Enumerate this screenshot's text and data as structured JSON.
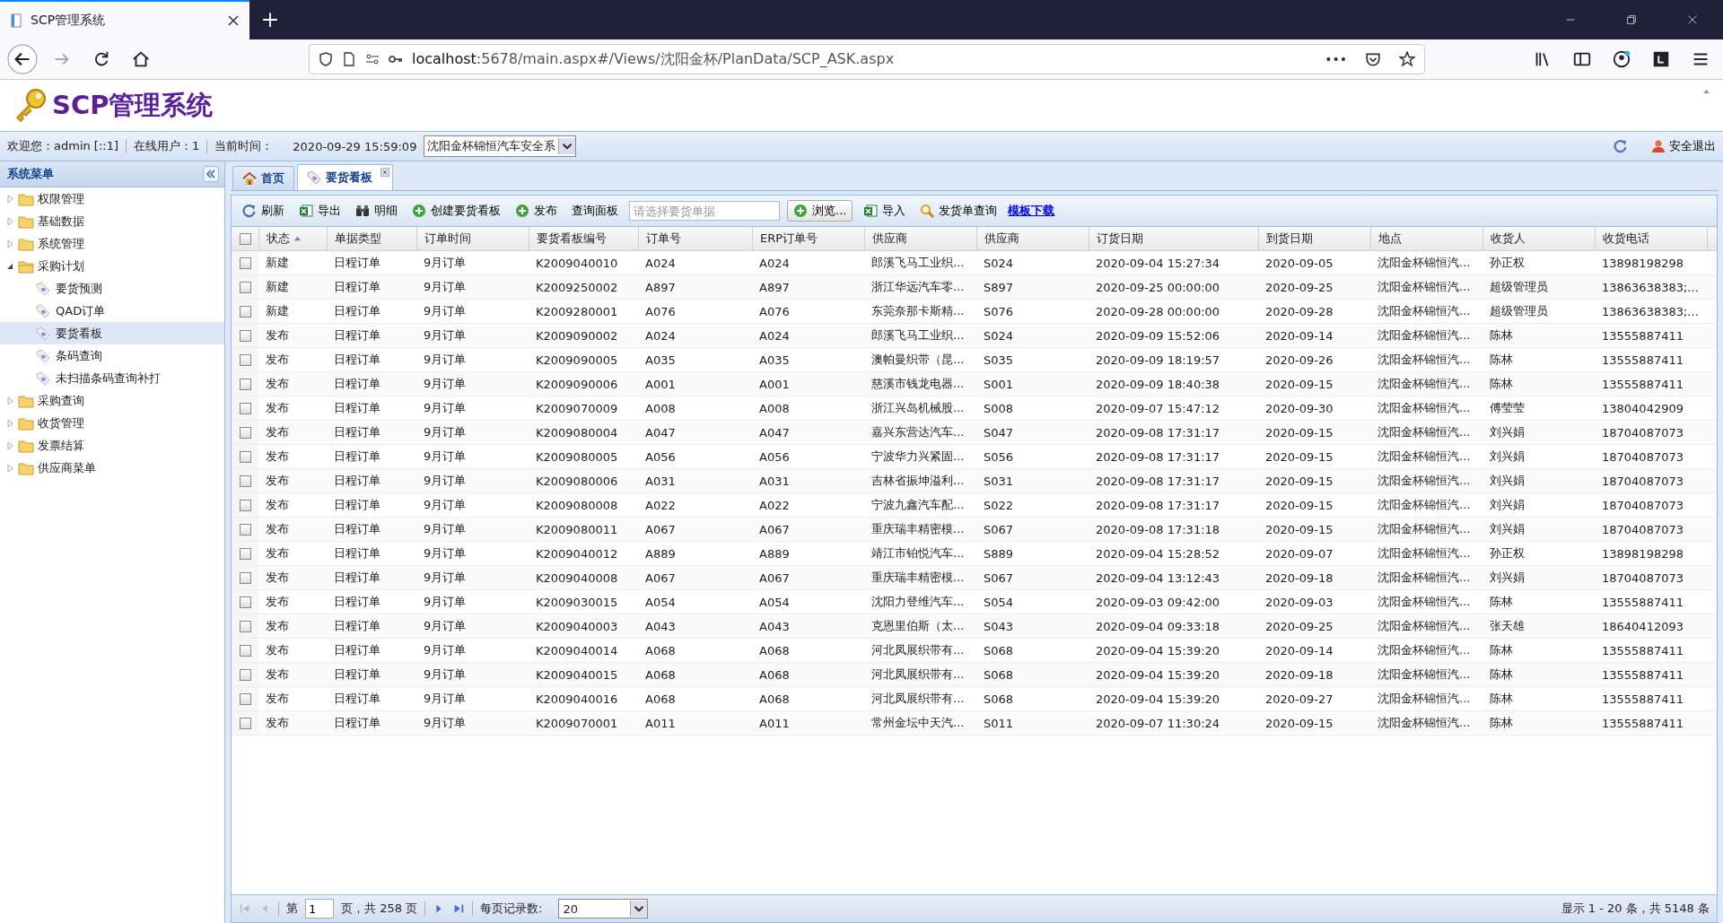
{
  "browser": {
    "tab_title": "SCP管理系统",
    "url_host": "localhost",
    "url_rest": ":5678/main.aspx#/Views/沈阳金杯/PlanData/SCP_ASK.aspx",
    "menu_dots": "•••"
  },
  "app_title": "SCP管理系统",
  "info_bar": {
    "welcome": "欢迎您：admin [::1]",
    "online": "在线用户：1",
    "time_label": "当前时间：",
    "time": "2020-09-29 15:59:09",
    "company": "沈阳金杯锦恒汽车安全系",
    "logout": "安全退出"
  },
  "sidebar": {
    "title": "系统菜单",
    "items": [
      {
        "label": "权限管理",
        "expanded": false
      },
      {
        "label": "基础数据",
        "expanded": false
      },
      {
        "label": "系统管理",
        "expanded": false
      },
      {
        "label": "采购计划",
        "expanded": true,
        "children": [
          {
            "label": "要货预测",
            "selected": false
          },
          {
            "label": "QAD订单",
            "selected": false
          },
          {
            "label": "要货看板",
            "selected": true
          },
          {
            "label": "条码查询",
            "selected": false
          },
          {
            "label": "未扫描条码查询补打",
            "selected": false
          }
        ]
      },
      {
        "label": "采购查询",
        "expanded": false
      },
      {
        "label": "收货管理",
        "expanded": false
      },
      {
        "label": "发票结算",
        "expanded": false
      },
      {
        "label": "供应商菜单",
        "expanded": false
      }
    ]
  },
  "tabs": [
    {
      "label": "首页",
      "closable": false,
      "selected": false
    },
    {
      "label": "要货看板",
      "closable": true,
      "selected": true
    }
  ],
  "toolbar": [
    {
      "kind": "refresh",
      "label": "刷新"
    },
    {
      "kind": "export",
      "label": "导出"
    },
    {
      "kind": "detail",
      "label": "明细"
    },
    {
      "kind": "create",
      "label": "创建要货看板"
    },
    {
      "kind": "publish",
      "label": "发布"
    },
    {
      "kind": "panel",
      "label": "查询面板"
    },
    {
      "kind": "field",
      "placeholder": "请选择要货单据"
    },
    {
      "kind": "browse",
      "label": "浏览..."
    },
    {
      "kind": "import",
      "label": "导入"
    },
    {
      "kind": "search",
      "label": "发货单查询"
    },
    {
      "kind": "link",
      "label": "模板下载"
    }
  ],
  "table": {
    "header_checked": false,
    "columns": [
      {
        "label": "状态",
        "sorted": true
      },
      {
        "label": "单据类型",
        "sorted": false
      },
      {
        "label": "订单时间",
        "sorted": false
      },
      {
        "label": "要货看板编号",
        "sorted": false
      },
      {
        "label": "订单号",
        "sorted": false
      },
      {
        "label": "ERP订单号",
        "sorted": false
      },
      {
        "label": "供应商",
        "sorted": false
      },
      {
        "label": "供应商",
        "sorted": false
      },
      {
        "label": "订货日期",
        "sorted": false
      },
      {
        "label": "到货日期",
        "sorted": false
      },
      {
        "label": "地点",
        "sorted": false
      },
      {
        "label": "收货人",
        "sorted": false
      },
      {
        "label": "收货电话",
        "sorted": false
      }
    ],
    "rows": [
      {
        "checked": false,
        "cells": [
          "新建",
          "日程订单",
          "9月订单",
          "K2009040010",
          "A024",
          "A024",
          "郎溪飞马工业织...",
          "S024",
          "2020-09-04 15:27:34",
          "2020-09-05",
          "沈阳金杯锦恒汽...",
          "孙正权",
          "13898198298"
        ]
      },
      {
        "checked": false,
        "cells": [
          "新建",
          "日程订单",
          "9月订单",
          "K2009250002",
          "A897",
          "A897",
          "浙江华远汽车零...",
          "S897",
          "2020-09-25 00:00:00",
          "2020-09-25",
          "沈阳金杯锦恒汽...",
          "超级管理员",
          "13863638383;..."
        ]
      },
      {
        "checked": false,
        "cells": [
          "新建",
          "日程订单",
          "9月订单",
          "K2009280001",
          "A076",
          "A076",
          "东莞奈那卡斯精...",
          "S076",
          "2020-09-28 00:00:00",
          "2020-09-28",
          "沈阳金杯锦恒汽...",
          "超级管理员",
          "13863638383;..."
        ]
      },
      {
        "checked": false,
        "cells": [
          "发布",
          "日程订单",
          "9月订单",
          "K2009090002",
          "A024",
          "A024",
          "郎溪飞马工业织...",
          "S024",
          "2020-09-09 15:52:06",
          "2020-09-14",
          "沈阳金杯锦恒汽...",
          "陈林",
          "13555887411"
        ]
      },
      {
        "checked": false,
        "cells": [
          "发布",
          "日程订单",
          "9月订单",
          "K2009090005",
          "A035",
          "A035",
          "澳帕曼织带（昆...",
          "S035",
          "2020-09-09 18:19:57",
          "2020-09-26",
          "沈阳金杯锦恒汽...",
          "陈林",
          "13555887411"
        ]
      },
      {
        "checked": false,
        "cells": [
          "发布",
          "日程订单",
          "9月订单",
          "K2009090006",
          "A001",
          "A001",
          "慈溪市钱龙电器...",
          "S001",
          "2020-09-09 18:40:38",
          "2020-09-15",
          "沈阳金杯锦恒汽...",
          "陈林",
          "13555887411"
        ]
      },
      {
        "checked": false,
        "cells": [
          "发布",
          "日程订单",
          "9月订单",
          "K2009070009",
          "A008",
          "A008",
          "浙江兴岛机械股...",
          "S008",
          "2020-09-07 15:47:12",
          "2020-09-30",
          "沈阳金杯锦恒汽...",
          "傅莹莹",
          "13804042909"
        ]
      },
      {
        "checked": false,
        "cells": [
          "发布",
          "日程订单",
          "9月订单",
          "K2009080004",
          "A047",
          "A047",
          "嘉兴东营达汽车...",
          "S047",
          "2020-09-08 17:31:17",
          "2020-09-15",
          "沈阳金杯锦恒汽...",
          "刘兴娟",
          "18704087073"
        ]
      },
      {
        "checked": false,
        "cells": [
          "发布",
          "日程订单",
          "9月订单",
          "K2009080005",
          "A056",
          "A056",
          "宁波华力兴紧固...",
          "S056",
          "2020-09-08 17:31:17",
          "2020-09-15",
          "沈阳金杯锦恒汽...",
          "刘兴娟",
          "18704087073"
        ]
      },
      {
        "checked": false,
        "cells": [
          "发布",
          "日程订单",
          "9月订单",
          "K2009080006",
          "A031",
          "A031",
          "吉林省振坤溢利...",
          "S031",
          "2020-09-08 17:31:17",
          "2020-09-15",
          "沈阳金杯锦恒汽...",
          "刘兴娟",
          "18704087073"
        ]
      },
      {
        "checked": false,
        "cells": [
          "发布",
          "日程订单",
          "9月订单",
          "K2009080008",
          "A022",
          "A022",
          "宁波九鑫汽车配...",
          "S022",
          "2020-09-08 17:31:17",
          "2020-09-15",
          "沈阳金杯锦恒汽...",
          "刘兴娟",
          "18704087073"
        ]
      },
      {
        "checked": false,
        "cells": [
          "发布",
          "日程订单",
          "9月订单",
          "K2009080011",
          "A067",
          "A067",
          "重庆瑞丰精密模...",
          "S067",
          "2020-09-08 17:31:18",
          "2020-09-15",
          "沈阳金杯锦恒汽...",
          "刘兴娟",
          "18704087073"
        ]
      },
      {
        "checked": false,
        "cells": [
          "发布",
          "日程订单",
          "9月订单",
          "K2009040012",
          "A889",
          "A889",
          "靖江市铂悦汽车...",
          "S889",
          "2020-09-04 15:28:52",
          "2020-09-07",
          "沈阳金杯锦恒汽...",
          "孙正权",
          "13898198298"
        ]
      },
      {
        "checked": false,
        "cells": [
          "发布",
          "日程订单",
          "9月订单",
          "K2009040008",
          "A067",
          "A067",
          "重庆瑞丰精密模...",
          "S067",
          "2020-09-04 13:12:43",
          "2020-09-18",
          "沈阳金杯锦恒汽...",
          "刘兴娟",
          "18704087073"
        ]
      },
      {
        "checked": false,
        "cells": [
          "发布",
          "日程订单",
          "9月订单",
          "K2009030015",
          "A054",
          "A054",
          "沈阳力登维汽车...",
          "S054",
          "2020-09-03 09:42:00",
          "2020-09-03",
          "沈阳金杯锦恒汽...",
          "陈林",
          "13555887411"
        ]
      },
      {
        "checked": false,
        "cells": [
          "发布",
          "日程订单",
          "9月订单",
          "K2009040003",
          "A043",
          "A043",
          "克恩里伯斯（太...",
          "S043",
          "2020-09-04 09:33:18",
          "2020-09-25",
          "沈阳金杯锦恒汽...",
          "张天雄",
          "18640412093"
        ]
      },
      {
        "checked": false,
        "cells": [
          "发布",
          "日程订单",
          "9月订单",
          "K2009040014",
          "A068",
          "A068",
          "河北凤展织带有...",
          "S068",
          "2020-09-04 15:39:20",
          "2020-09-14",
          "沈阳金杯锦恒汽...",
          "陈林",
          "13555887411"
        ]
      },
      {
        "checked": false,
        "cells": [
          "发布",
          "日程订单",
          "9月订单",
          "K2009040015",
          "A068",
          "A068",
          "河北凤展织带有...",
          "S068",
          "2020-09-04 15:39:20",
          "2020-09-18",
          "沈阳金杯锦恒汽...",
          "陈林",
          "13555887411"
        ]
      },
      {
        "checked": false,
        "cells": [
          "发布",
          "日程订单",
          "9月订单",
          "K2009040016",
          "A068",
          "A068",
          "河北凤展织带有...",
          "S068",
          "2020-09-04 15:39:20",
          "2020-09-27",
          "沈阳金杯锦恒汽...",
          "陈林",
          "13555887411"
        ]
      },
      {
        "checked": false,
        "cells": [
          "发布",
          "日程订单",
          "9月订单",
          "K2009070001",
          "A011",
          "A011",
          "常州金坛中天汽...",
          "S011",
          "2020-09-07 11:30:24",
          "2020-09-15",
          "沈阳金杯锦恒汽...",
          "陈林",
          "13555887411"
        ]
      }
    ]
  },
  "pager": {
    "page_prefix": "第",
    "page": "1",
    "page_suffix": "页，共 258 页",
    "per_page_label": "每页记录数:",
    "per_page": "20",
    "summary": "显示 1 - 20 条，共 5148 条"
  }
}
